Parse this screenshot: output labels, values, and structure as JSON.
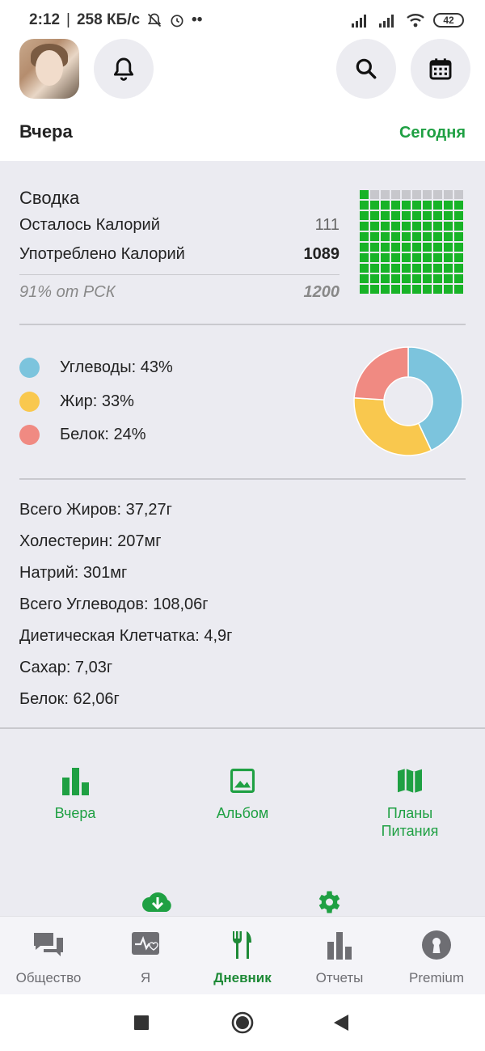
{
  "status_bar": {
    "time": "2:12",
    "speed": "258 КБ/с",
    "dots": "••",
    "battery": "42"
  },
  "header": {
    "icons": [
      "bell-icon",
      "search-icon",
      "calendar-icon"
    ],
    "prev_day": "Вчера",
    "today": "Сегодня"
  },
  "summary": {
    "title": "Сводка",
    "remaining_label": "Осталось Калорий",
    "remaining_value": "111",
    "consumed_label": "Употреблено Калорий",
    "consumed_value": "1089",
    "percent_label": "91% от РСК",
    "goal_value": "1200",
    "filled_fraction": 0.91
  },
  "macros": {
    "items": [
      {
        "label": "Углеводы: 43%",
        "percent": 43,
        "color": "#7cc4dd"
      },
      {
        "label": "Жир: 33%",
        "percent": 33,
        "color": "#f9c84e"
      },
      {
        "label": "Белок: 24%",
        "percent": 24,
        "color": "#f08a82"
      }
    ]
  },
  "nutrients": [
    "Всего Жиров: 37,27г",
    "Холестерин: 207мг",
    "Натрий: 301мг",
    "Всего Углеводов: 108,06г",
    "Диетическая Клетчатка: 4,9г",
    "Сахар: 7,03г",
    "Белок: 62,06г"
  ],
  "shortcuts": [
    {
      "label": "Вчера",
      "icon": "bar-chart-icon"
    },
    {
      "label": "Альбом",
      "icon": "image-icon"
    },
    {
      "label": "Планы\nПитания",
      "icon": "map-icon"
    }
  ],
  "bottom_nav": [
    {
      "label": "Общество",
      "icon": "chat-icon",
      "active": false
    },
    {
      "label": "Я",
      "icon": "health-icon",
      "active": false
    },
    {
      "label": "Дневник",
      "icon": "fork-knife-icon",
      "active": true
    },
    {
      "label": "Отчеты",
      "icon": "bar-chart-icon",
      "active": false
    },
    {
      "label": "Premium",
      "icon": "keyhole-icon",
      "active": false
    }
  ],
  "colors": {
    "accent": "#1fa043",
    "panel": "#ebebf1",
    "grid_fill": "#18b327",
    "grid_empty": "#c7c7cc"
  }
}
